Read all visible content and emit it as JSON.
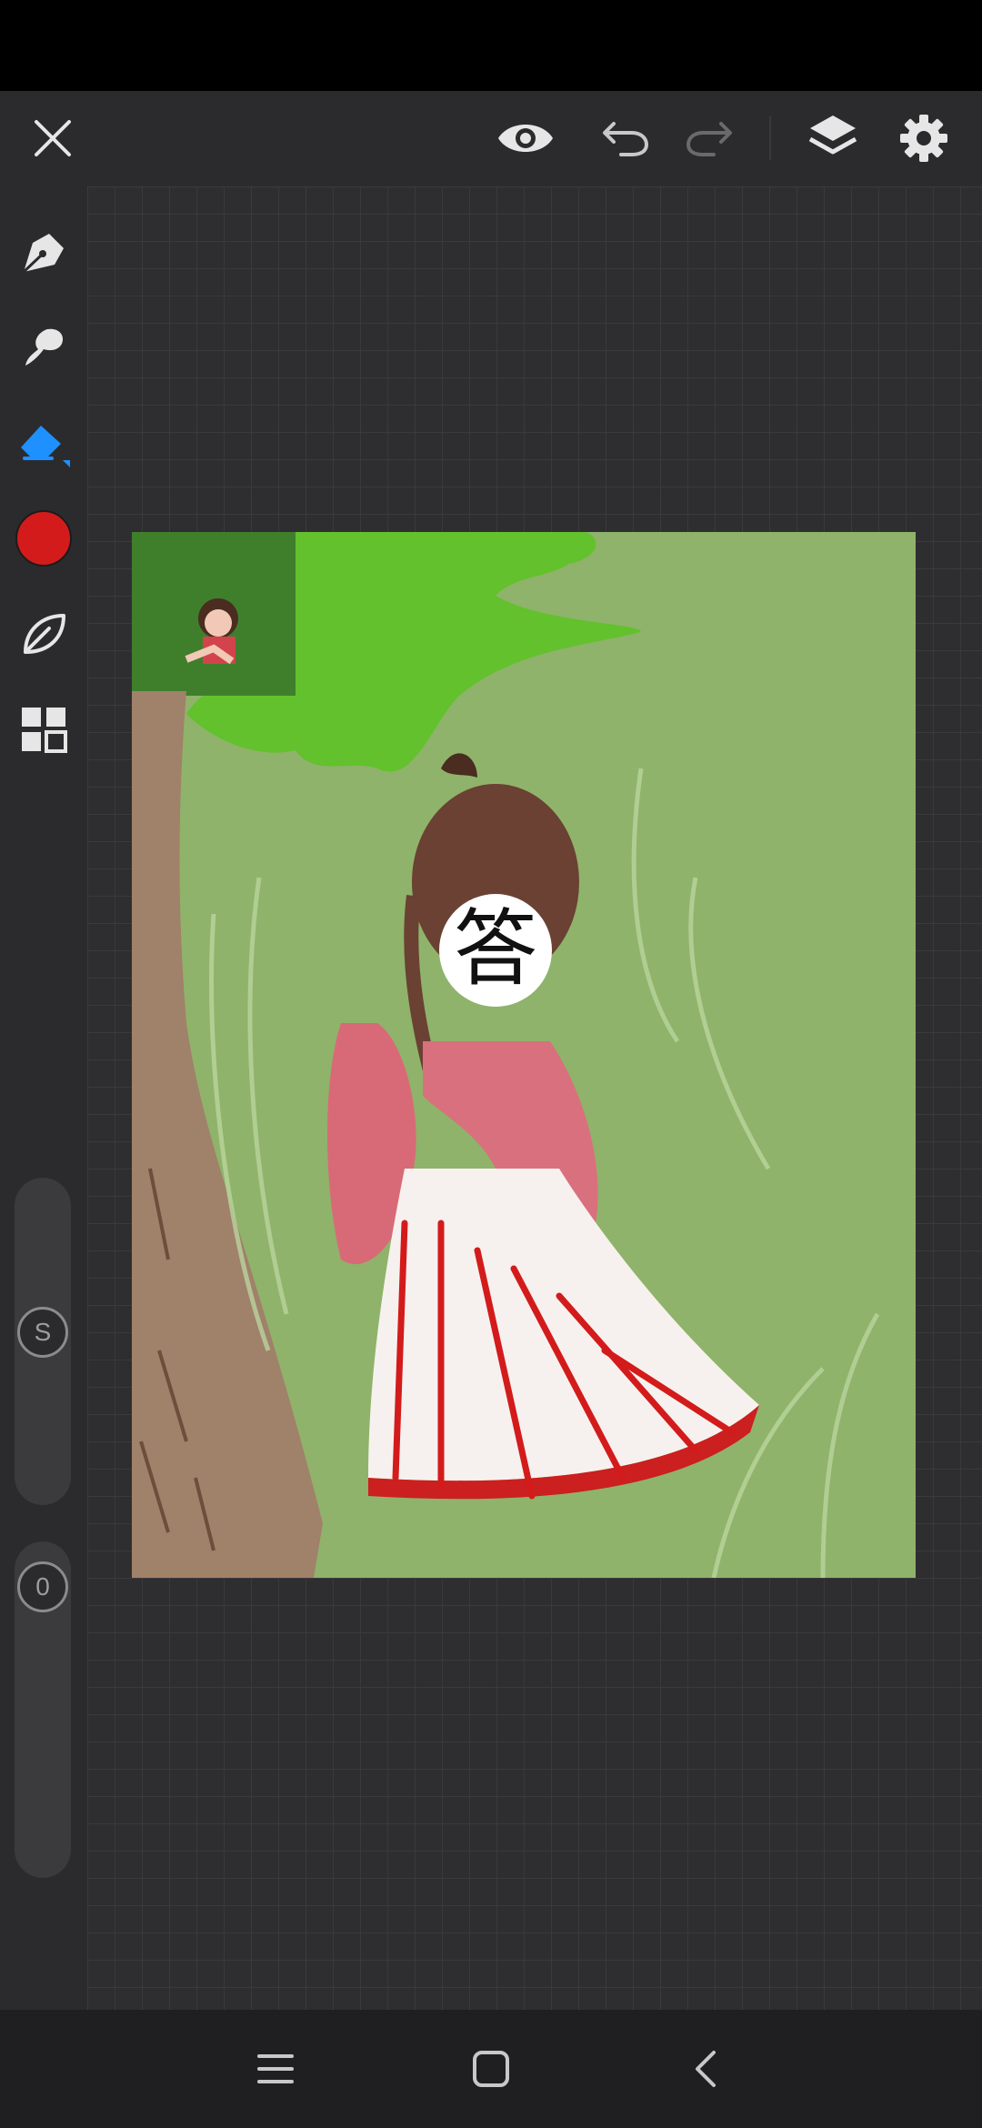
{
  "app": {
    "accent_color": "#1e90ff",
    "icon_color": "#e6e6e6"
  },
  "toolbar": {
    "items": [
      "close-icon",
      "eye-icon",
      "undo-icon",
      "redo-icon",
      "layers-icon",
      "gear-icon"
    ]
  },
  "tools": {
    "items": [
      "pen-icon",
      "smudge-icon",
      "eraser-icon",
      "color-swatch",
      "leaf-brush-icon",
      "gallery-grid-icon"
    ],
    "active_tool": "eraser-icon",
    "current_color": "#d41b1b"
  },
  "sliders": {
    "size_label": "S",
    "opacity_label": "0"
  },
  "canvas": {
    "face_character": "答"
  },
  "navigation": {
    "items": [
      "menu-icon",
      "home-icon",
      "back-icon"
    ]
  }
}
